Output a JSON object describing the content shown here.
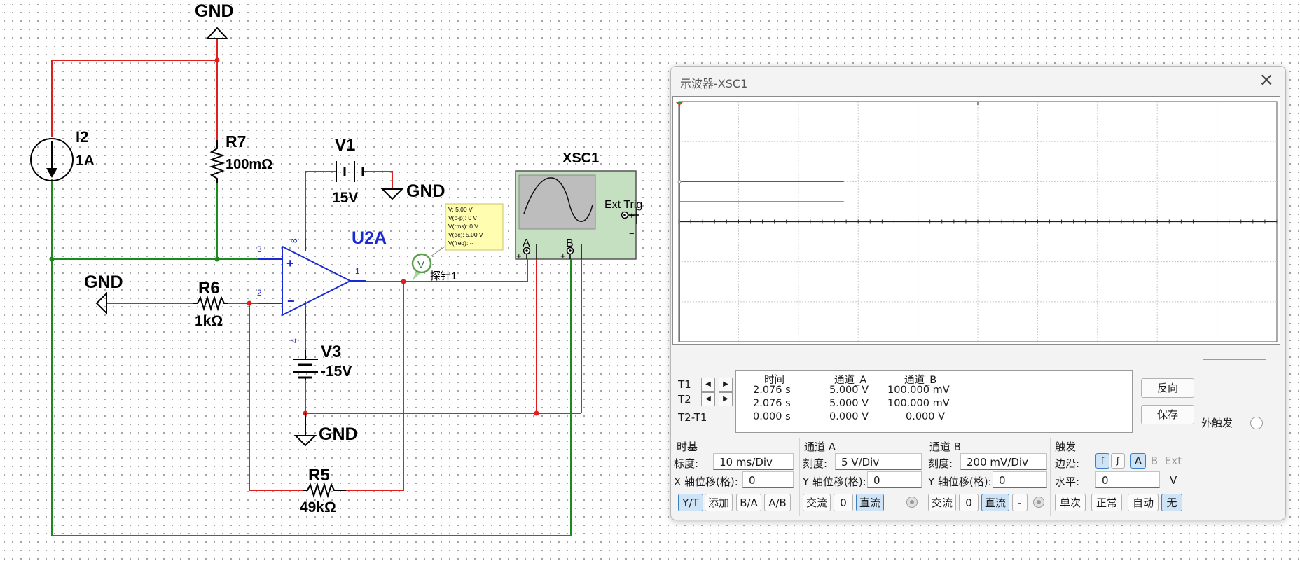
{
  "schematic": {
    "gnd_label": "GND",
    "I2": {
      "name": "I2",
      "value": "1A"
    },
    "R7": {
      "name": "R7",
      "value": "100mΩ"
    },
    "V1": {
      "name": "V1",
      "value": "15V"
    },
    "U2A": {
      "name": "U2A",
      "pin_3": "3",
      "pin_8": "8",
      "pin_1": "1",
      "pin_2": "2",
      "pin_4": "4",
      "plus": "+",
      "minus": "−"
    },
    "R6": {
      "name": "R6",
      "value": "1kΩ"
    },
    "V3": {
      "name": "V3",
      "value": "-15V"
    },
    "R5": {
      "name": "R5",
      "value": "49kΩ"
    },
    "XSC1": {
      "name": "XSC1",
      "ext_trig": "Ext Trig",
      "ch_a": "A",
      "ch_b": "B",
      "plus": "+",
      "minus": "−"
    },
    "probe": {
      "name": "探针1",
      "symbol": "V",
      "tooltip": [
        "V: 5.00 V",
        "V(p-p): 0 V",
        "V(rms): 0 V",
        "V(dc): 5.00 V",
        "V(freq): --"
      ]
    }
  },
  "scope": {
    "title": "示波器-XSC1",
    "close_icon": "×",
    "trace_colors": {
      "channel_a": "#e02020",
      "channel_b": "#21a021",
      "cursor": "#c040c0",
      "grid": "#c8c8c8"
    },
    "readout": {
      "t1_label": "T1",
      "t2_label": "T2",
      "t2t1_label": "T2-T1",
      "headers": [
        "时间",
        "通道_A",
        "通道_B"
      ],
      "rows": [
        [
          "2.076 s",
          "5.000 V",
          "100.000 mV"
        ],
        [
          "2.076 s",
          "5.000 V",
          "100.000 mV"
        ],
        [
          "0.000 s",
          "0.000 V",
          "0.000 V"
        ]
      ]
    },
    "buttons": {
      "reverse": "反向",
      "save": "保存",
      "ext_trigger": "外触发"
    },
    "timebase": {
      "title": "时基",
      "scale_label": "标度:",
      "scale": "10 ms/Div",
      "xpos_label": "X 轴位移(格):",
      "xpos": "0",
      "modes": [
        "Y/T",
        "添加",
        "B/A",
        "A/B"
      ]
    },
    "channel_a": {
      "title": "通道 A",
      "scale_label": "刻度:",
      "scale": "5  V/Div",
      "ypos_label": "Y 轴位移(格):",
      "ypos": "0",
      "coupling": [
        "交流",
        "0",
        "直流"
      ]
    },
    "channel_b": {
      "title": "通道 B",
      "scale_label": "刻度:",
      "scale": "200 mV/Div",
      "ypos_label": "Y 轴位移(格):",
      "ypos": "0",
      "coupling": [
        "交流",
        "0",
        "直流",
        "-"
      ]
    },
    "trigger": {
      "title": "触发",
      "edge_label": "边沿:",
      "edge_buttons": [
        "f",
        "ʃ",
        "A",
        "B",
        "Ext"
      ],
      "level_label": "水平:",
      "level": "0",
      "level_unit": "V",
      "modes": [
        "单次",
        "正常",
        "自动",
        "无"
      ]
    }
  },
  "chart_data": {
    "type": "line",
    "title": "",
    "xlabel": "",
    "ylabel": "",
    "x_divisions": 10,
    "y_divisions": 6,
    "series": [
      {
        "name": "通道_A",
        "values": [
          [
            0,
            5.0
          ],
          [
            27.6,
            5.0
          ]
        ]
      },
      {
        "name": "通道_B",
        "values": [
          [
            0,
            0.1
          ],
          [
            27.6,
            0.1
          ]
        ]
      }
    ]
  }
}
